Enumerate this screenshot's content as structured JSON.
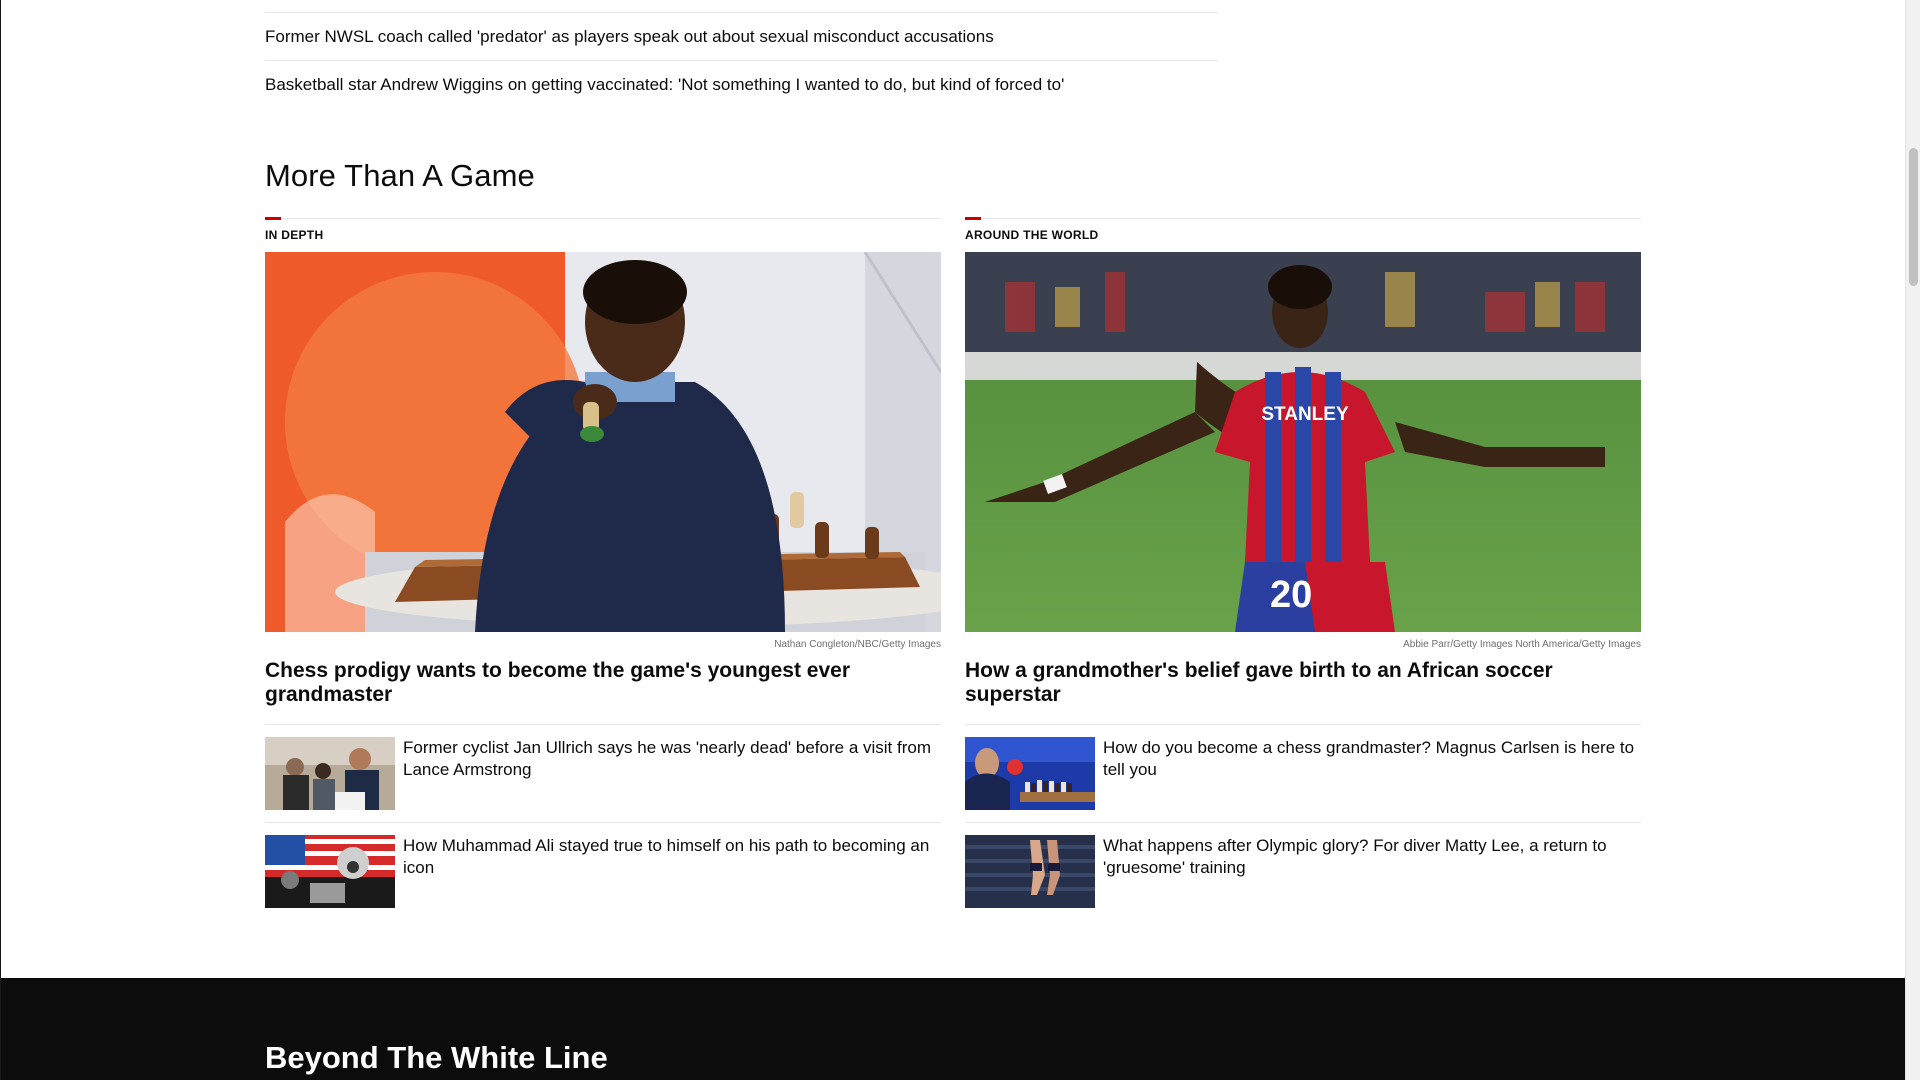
{
  "top_list": [
    "Former NWSL coach called 'predator' as players speak out about sexual misconduct accusations",
    "Basketball star Andrew Wiggins on getting vaccinated: 'Not something I wanted to do, but kind of forced to'"
  ],
  "section": {
    "title": "More Than A Game"
  },
  "left_column": {
    "kicker": "IN DEPTH",
    "credit": "Nathan Congleton/NBC/Getty Images",
    "headline": "Chess prodigy wants to become the game's youngest ever grandmaster",
    "cards": [
      {
        "text": "Former cyclist Jan Ullrich says he was 'nearly dead' before a visit from Lance Armstrong"
      },
      {
        "text": "How Muhammad Ali stayed true to himself on his path to becoming an icon"
      }
    ]
  },
  "right_column": {
    "kicker": "AROUND THE WORLD",
    "credit": "Abbie Parr/Getty Images North America/Getty Images",
    "headline": "How a grandmother's belief gave birth to an African soccer superstar",
    "cards": [
      {
        "text": "How do you become a chess grandmaster? Magnus Carlsen is here to tell you"
      },
      {
        "text": "What happens after Olympic glory? For diver Matty Lee, a return to 'gruesome' training"
      }
    ]
  },
  "jersey": {
    "sponsor": "STANLEY",
    "number": "20"
  },
  "next_section": {
    "title": "Beyond The White Line"
  }
}
